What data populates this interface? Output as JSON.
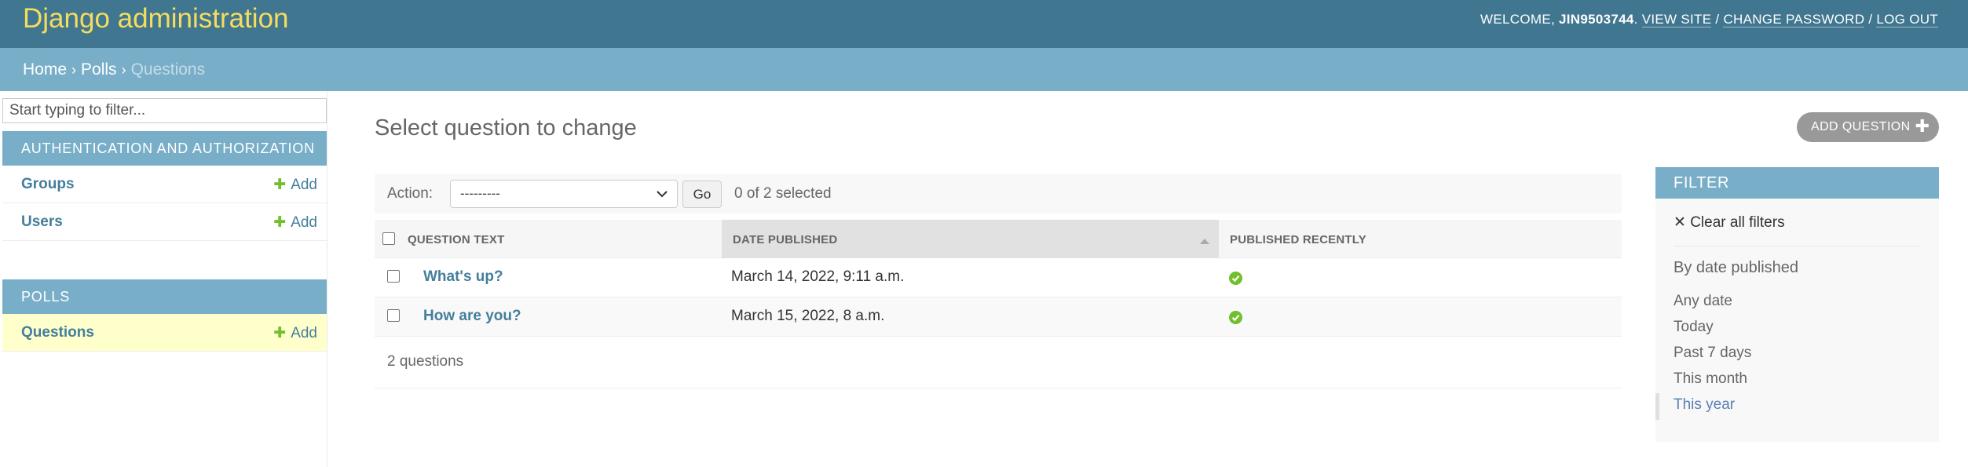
{
  "header": {
    "site_name": "Django administration",
    "welcome_prefix": "Welcome, ",
    "username": "JIN9503744",
    "view_site": "View site",
    "change_password": "Change password",
    "log_out": "Log out",
    "separator": " / "
  },
  "breadcrumbs": {
    "home": "Home",
    "app": "Polls",
    "current": "Questions",
    "separator": "›"
  },
  "sidebar": {
    "filter_placeholder": "Start typing to filter...",
    "apps": [
      {
        "name": "Authentication and Authorization",
        "models": [
          {
            "name": "Groups",
            "add_label": "Add"
          },
          {
            "name": "Users",
            "add_label": "Add"
          }
        ]
      },
      {
        "name": "Polls",
        "models": [
          {
            "name": "Questions",
            "add_label": "Add",
            "selected": true
          }
        ]
      }
    ]
  },
  "main": {
    "title": "Select question to change",
    "add_button": "Add question",
    "actions": {
      "label": "Action:",
      "selected_option": "---------",
      "go_label": "Go",
      "selection_count": "0 of 2 selected"
    },
    "table": {
      "columns": [
        "Question text",
        "Date published",
        "Published recently"
      ],
      "sorted_column": "Date published",
      "rows": [
        {
          "question_text": "What's up?",
          "date_published": "March 14, 2022, 9:11 a.m.",
          "published_recently": true
        },
        {
          "question_text": "How are you?",
          "date_published": "March 15, 2022, 8 a.m.",
          "published_recently": true
        }
      ]
    },
    "paginator": "2 questions"
  },
  "filter": {
    "header": "Filter",
    "clear_all": "Clear all filters",
    "title": "By date published",
    "choices": [
      "Any date",
      "Today",
      "Past 7 days",
      "This month",
      "This year"
    ],
    "selected_choice": "This year"
  },
  "colors": {
    "header_bg": "#417690",
    "site_name": "#f5dd5d",
    "breadcrumbs_bg": "#79aec8",
    "link": "#447e9b",
    "add_green": "#70bf2b",
    "selected_row": "#ffffcc"
  }
}
